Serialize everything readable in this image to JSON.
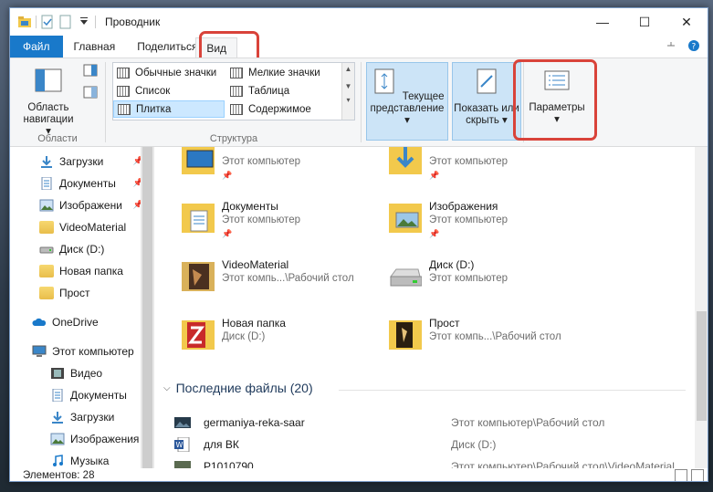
{
  "window": {
    "title": "Проводник",
    "controls": {
      "minimize": "—",
      "maximize": "☐",
      "close": "✕"
    }
  },
  "tabs": [
    {
      "label": "Файл"
    },
    {
      "label": "Главная"
    },
    {
      "label": "Поделиться"
    },
    {
      "label": "Вид"
    }
  ],
  "ribbon": {
    "panes": {
      "nav_pane_label": "Область навигации",
      "group_label": "Области"
    },
    "layout": {
      "items": [
        "Обычные значки",
        "Мелкие значки",
        "Список",
        "Таблица",
        "Плитка",
        "Содержимое"
      ],
      "selected": "Плитка",
      "group_label": "Структура"
    },
    "current_view_label": "Текущее представление",
    "show_hide_label": "Показать или скрыть",
    "options_label": "Параметры"
  },
  "nav": {
    "items": [
      {
        "label": "Загрузки",
        "icon": "download-icon",
        "pinned": true
      },
      {
        "label": "Документы",
        "icon": "documents-icon",
        "pinned": true
      },
      {
        "label": "Изображени",
        "icon": "pictures-icon",
        "pinned": true
      },
      {
        "label": "VideoMaterial",
        "icon": "folder-icon",
        "pinned": false
      },
      {
        "label": "Диск (D:)",
        "icon": "drive-icon",
        "pinned": false
      },
      {
        "label": "Новая папка",
        "icon": "folder-icon",
        "pinned": false
      },
      {
        "label": "Прост",
        "icon": "folder-icon",
        "pinned": false
      },
      {
        "label": "OneDrive",
        "icon": "cloud-icon",
        "pinned": false
      },
      {
        "label": "Этот компьютер",
        "icon": "computer-icon",
        "pinned": false
      },
      {
        "label": "Видео",
        "icon": "video-icon",
        "pinned": false
      },
      {
        "label": "Документы",
        "icon": "documents-icon",
        "pinned": false
      },
      {
        "label": "Загрузки",
        "icon": "download-icon",
        "pinned": false
      },
      {
        "label": "Изображения",
        "icon": "pictures-icon",
        "pinned": false
      },
      {
        "label": "Музыка",
        "icon": "music-icon",
        "pinned": false
      }
    ]
  },
  "tiles": [
    {
      "name": "",
      "desc": "Этот компьютер",
      "pinned": true
    },
    {
      "name": "",
      "desc": "Этот компьютер",
      "pinned": true
    },
    {
      "name": "Документы",
      "desc": "Этот компьютер",
      "pinned": true
    },
    {
      "name": "Изображения",
      "desc": "Этот компьютер",
      "pinned": true
    },
    {
      "name": "VideoMaterial",
      "desc": "Этот компь...\\Рабочий стол",
      "pinned": false
    },
    {
      "name": "Диск (D:)",
      "desc": "Этот компьютер",
      "pinned": false
    },
    {
      "name": "Новая папка",
      "desc": "Диск (D:)",
      "pinned": false
    },
    {
      "name": "Прост",
      "desc": "Этот компь...\\Рабочий стол",
      "pinned": false
    }
  ],
  "recent": {
    "header": "Последние файлы (20)",
    "rows": [
      {
        "name": "germaniya-reka-saar",
        "path": "Этот компьютер\\Рабочий стол"
      },
      {
        "name": "для ВК",
        "path": "Диск (D:)"
      },
      {
        "name": "P1010790",
        "path": "Этот компьютер\\Рабочий стол\\VideoMaterial"
      }
    ]
  },
  "status": {
    "items_count": "Элементов: 28"
  }
}
